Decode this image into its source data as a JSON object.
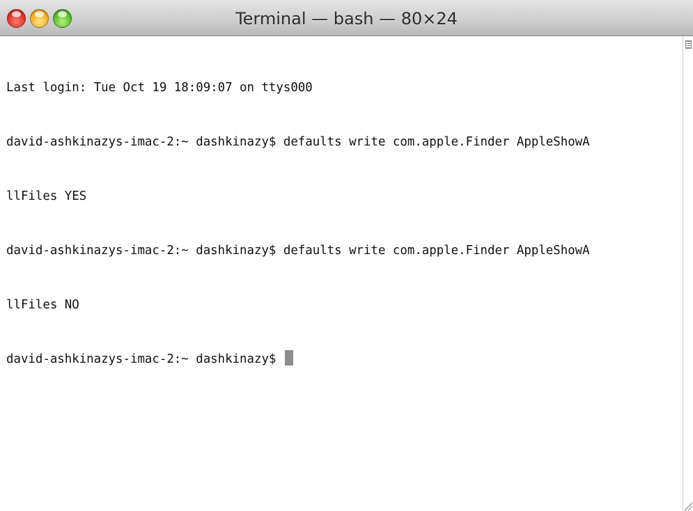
{
  "window": {
    "title": "Terminal — bash — 80×24"
  },
  "traffic_lights": {
    "close_color": "#e0352a",
    "minimize_color": "#f4b42a",
    "zoom_color": "#5bbf2f"
  },
  "terminal": {
    "lines": [
      "Last login: Tue Oct 19 18:09:07 on ttys000",
      "david-ashkinazys-imac-2:~ dashkinazy$ defaults write com.apple.Finder AppleShowA",
      "llFiles YES",
      "david-ashkinazys-imac-2:~ dashkinazy$ defaults write com.apple.Finder AppleShowA",
      "llFiles NO",
      "david-ashkinazys-imac-2:~ dashkinazy$ "
    ]
  },
  "icons": {
    "split": "split-pane-icon",
    "resize": "resize-grip-icon"
  }
}
